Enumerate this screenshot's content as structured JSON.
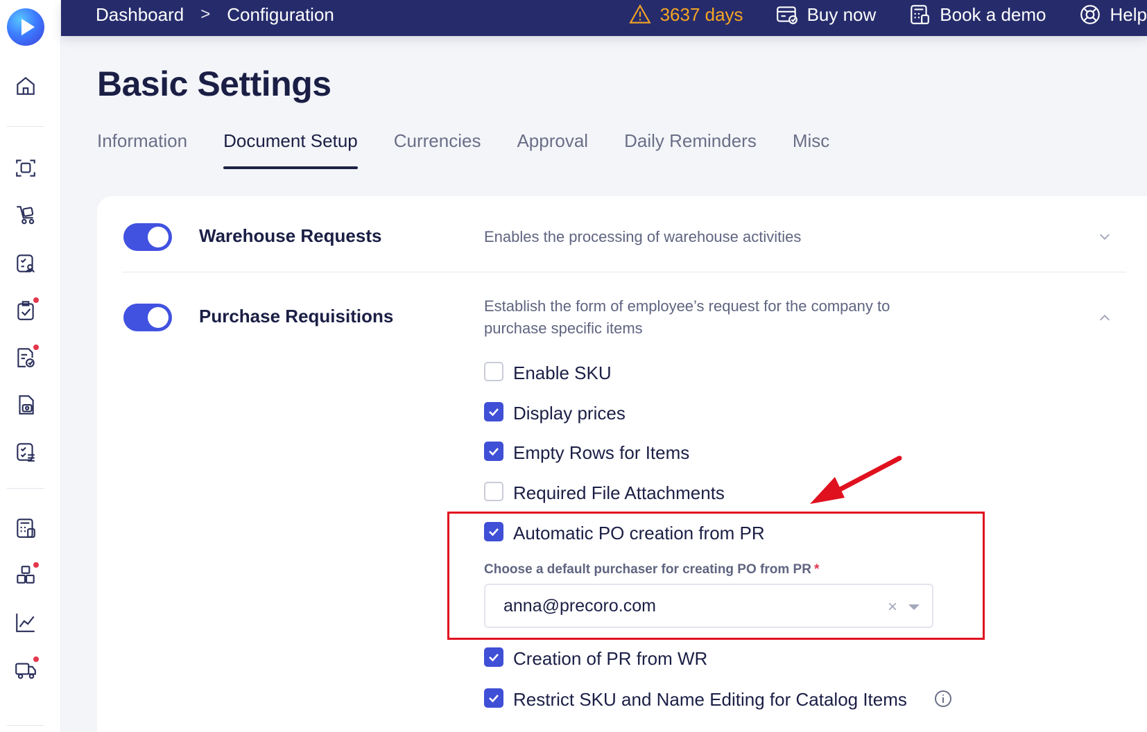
{
  "breadcrumbs": {
    "dashboard": "Dashboard",
    "separator": ">",
    "configuration": "Configuration"
  },
  "topbar": {
    "trial": "3637 days",
    "buy_now": "Buy now",
    "book_demo": "Book a demo",
    "help": "Help"
  },
  "page": {
    "title": "Basic Settings"
  },
  "tabs": [
    "Information",
    "Document Setup",
    "Currencies",
    "Approval",
    "Daily Reminders",
    "Misc"
  ],
  "active_tab": "Document Setup",
  "modules": {
    "warehouse": {
      "title": "Warehouse Requests",
      "description": "Enables the processing of warehouse activities",
      "enabled": true
    },
    "purchase": {
      "title": "Purchase Requisitions",
      "description_line1": "Establish the form of employee’s request for the company to",
      "description_line2": "purchase specific items",
      "enabled": true
    }
  },
  "options": [
    {
      "label": "Enable SKU",
      "checked": false
    },
    {
      "label": "Display prices",
      "checked": true
    },
    {
      "label": "Empty Rows for Items",
      "checked": true
    },
    {
      "label": "Required File Attachments",
      "checked": false
    },
    {
      "label": "Automatic PO creation from PR",
      "checked": true
    },
    {
      "label": "Creation of PR from WR",
      "checked": true
    },
    {
      "label": "Restrict SKU and Name Editing for Catalog Items",
      "checked": true
    }
  ],
  "purchaser": {
    "label": "Choose a default purchaser for creating PO from PR",
    "required_mark": "*",
    "value": "anna@precoro.com",
    "clear": "×"
  },
  "colors": {
    "topbar": "#262c6b",
    "accent": "#4152e0",
    "highlight": "#e0111f",
    "warning": "#f5a524",
    "badge": "#e5364b"
  },
  "icons": [
    "home-icon",
    "scan-icon",
    "cart-icon",
    "requests-icon",
    "approval-icon",
    "invoice-icon",
    "receipt-icon",
    "list-icon",
    "budget-icon",
    "items-icon",
    "analytics-icon",
    "delivery-icon",
    "warning-icon",
    "buy-icon",
    "demo-icon",
    "help-icon",
    "info-icon"
  ]
}
